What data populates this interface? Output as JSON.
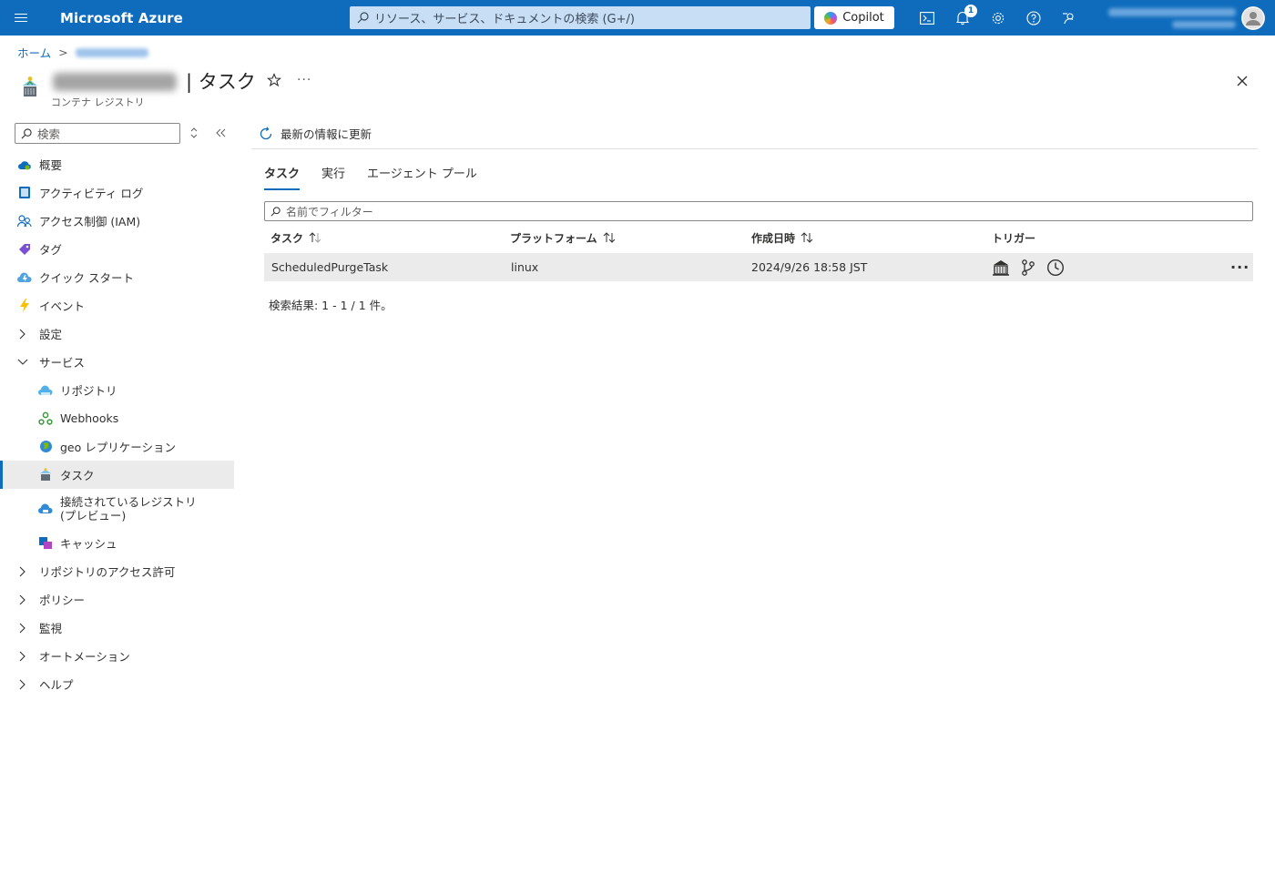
{
  "topbar": {
    "menu_icon": "hamburger-icon",
    "brand": "Microsoft Azure",
    "search_placeholder": "リソース、サービス、ドキュメントの検索 (G+/)",
    "copilot_label": "Copilot",
    "notification_count": "1",
    "icons": [
      "cloud-shell-icon",
      "bell-icon",
      "settings-icon",
      "help-icon",
      "feedback-icon"
    ],
    "accent": "#0f6cbd"
  },
  "breadcrumb": {
    "home": "ホーム",
    "separator": ">"
  },
  "header": {
    "title": "| タスク",
    "subtitle": "コンテナ レジストリ",
    "more": "···"
  },
  "nav": {
    "search_placeholder": "検索",
    "items": [
      {
        "label": "概要",
        "icon": "cloud-icon"
      },
      {
        "label": "アクティビティ ログ",
        "icon": "activity-log-icon"
      },
      {
        "label": "アクセス制御 (IAM)",
        "icon": "people-icon"
      },
      {
        "label": "タグ",
        "icon": "tag-icon"
      },
      {
        "label": "クイック スタート",
        "icon": "quickstart-icon"
      },
      {
        "label": "イベント",
        "icon": "lightning-icon"
      },
      {
        "label": "設定",
        "icon": "chevron-right-icon"
      },
      {
        "label": "サービス",
        "icon": "chevron-down-icon"
      },
      {
        "label": "リポジトリ",
        "icon": "repository-icon"
      },
      {
        "label": "Webhooks",
        "icon": "webhooks-icon"
      },
      {
        "label": "geo レプリケーション",
        "icon": "globe-icon"
      },
      {
        "label": "タスク",
        "icon": "task-icon"
      },
      {
        "label": "接続されているレジストリ (プレビュー)",
        "icon": "connected-registry-icon"
      },
      {
        "label": "キャッシュ",
        "icon": "cache-icon"
      },
      {
        "label": "リポジトリのアクセス許可",
        "icon": "chevron-right-icon"
      },
      {
        "label": "ポリシー",
        "icon": "chevron-right-icon"
      },
      {
        "label": "監視",
        "icon": "chevron-right-icon"
      },
      {
        "label": "オートメーション",
        "icon": "chevron-right-icon"
      },
      {
        "label": "ヘルプ",
        "icon": "chevron-right-icon"
      }
    ]
  },
  "main": {
    "refresh_label": "最新の情報に更新",
    "tabs": [
      "タスク",
      "実行",
      "エージェント プール"
    ],
    "filter_placeholder": "名前でフィルター",
    "columns": [
      "タスク",
      "プラットフォーム",
      "作成日時",
      "トリガー"
    ],
    "rows": [
      {
        "task": "ScheduledPurgeTask",
        "platform": "linux",
        "created": "2024/9/26 18:58 JST",
        "triggers": [
          "base-image-trigger-icon",
          "source-trigger-icon",
          "timer-trigger-icon"
        ],
        "more": "···"
      }
    ],
    "result_text": "検索結果: 1 - 1 / 1 件。"
  }
}
